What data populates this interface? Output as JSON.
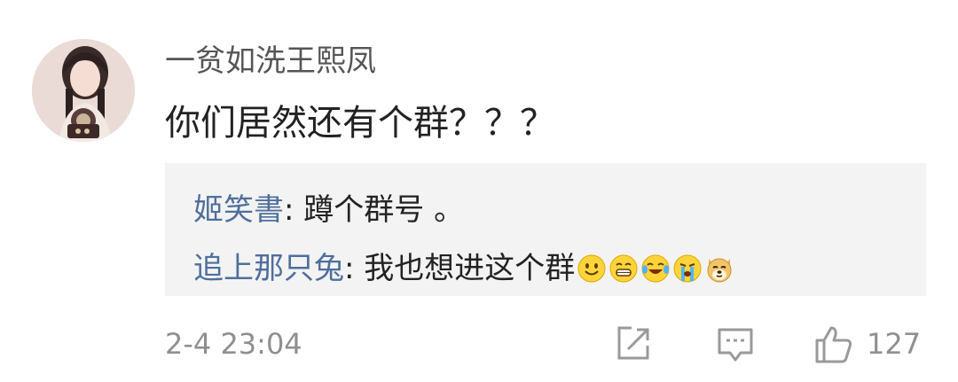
{
  "comment": {
    "username": "一贫如洗王熙凤",
    "text": "你们居然还有个群？？？"
  },
  "replies": [
    {
      "author": "姬笑書",
      "separator": ": ",
      "text": "蹲个群号 。",
      "emojis": []
    },
    {
      "author": "追上那只兔",
      "separator": ": ",
      "text": "我也想进这个群",
      "emojis": [
        "smile-emoji",
        "grin-emoji",
        "laugh-cry-emoji",
        "crying-emoji",
        "doge-emoji"
      ]
    }
  ],
  "footer": {
    "timestamp": "2-4 23:04",
    "like_count": "127",
    "icons": [
      "share-icon",
      "comment-icon",
      "like-icon"
    ]
  },
  "colors": {
    "reply_author": "#4e6f9b",
    "muted": "#8f8f8f",
    "reply_bg": "#f3f3f3"
  }
}
